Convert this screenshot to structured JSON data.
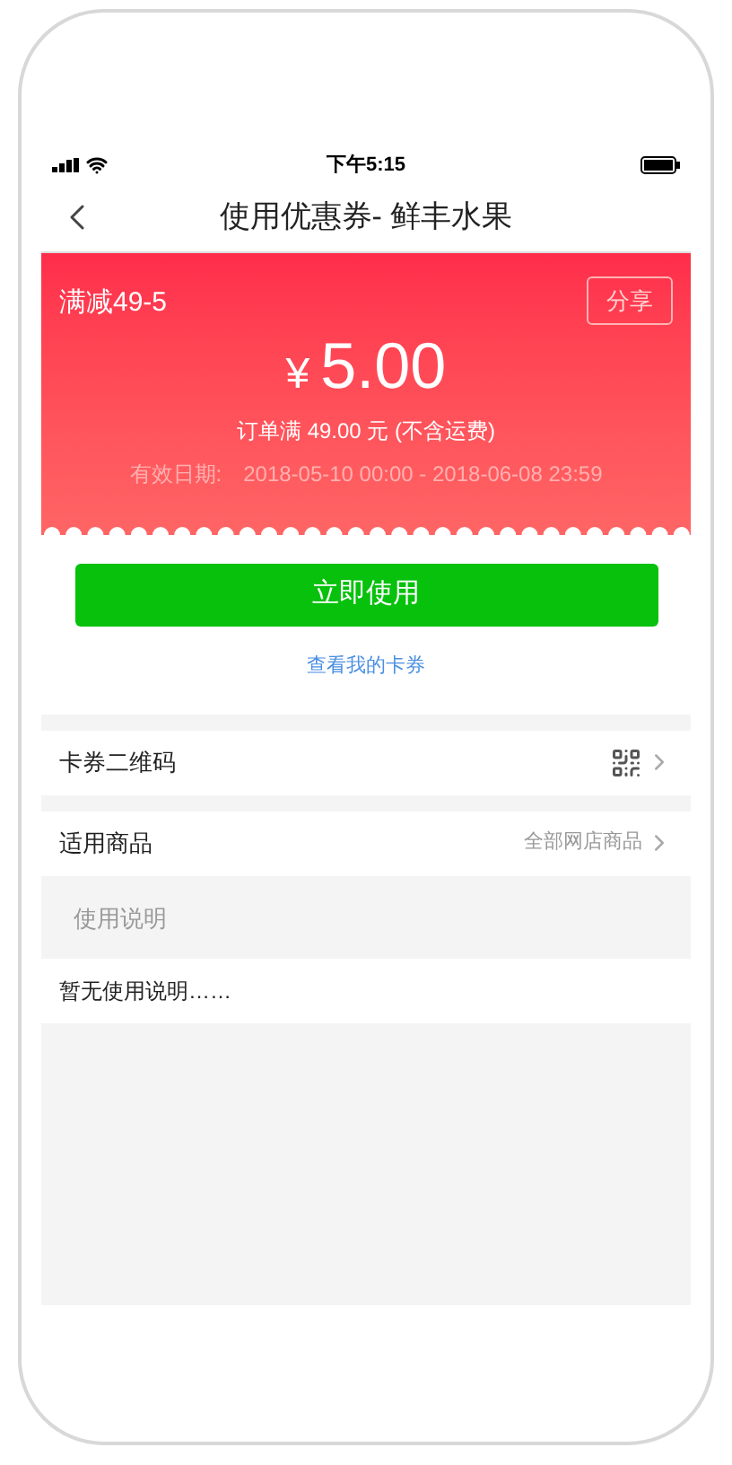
{
  "status_bar": {
    "time": "下午5:15"
  },
  "nav": {
    "title": "使用优惠券- 鲜丰水果"
  },
  "coupon": {
    "name": "满减49-5",
    "share": "分享",
    "currency": "¥",
    "amount": "5.00",
    "condition": "订单满 49.00 元 (不含运费)",
    "validity_label": "有效日期:",
    "validity": "2018-05-10 00:00 - 2018-06-08 23:59"
  },
  "use_button": "立即使用",
  "my_coupons_link": "查看我的卡券",
  "rows": [
    {
      "kind": "qr",
      "label": "卡券二维码"
    },
    {
      "kind": "value",
      "label": "适用商品",
      "value": "全部网店商品"
    }
  ],
  "instructions": {
    "header": "使用说明",
    "text": "暂无使用说明……"
  }
}
